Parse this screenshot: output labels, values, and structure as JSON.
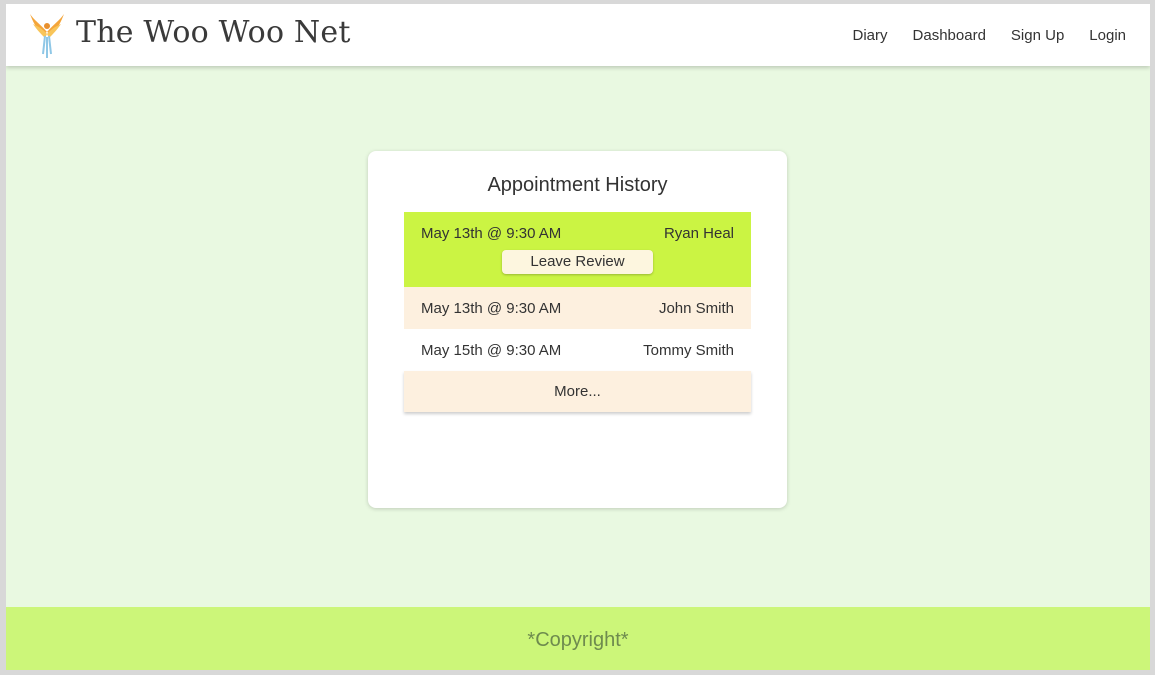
{
  "header": {
    "brand": "The Woo Woo Net",
    "logo_icon": "phoenix-logo-icon",
    "nav": [
      {
        "label": "Diary"
      },
      {
        "label": "Dashboard"
      },
      {
        "label": "Sign Up"
      },
      {
        "label": "Login"
      }
    ]
  },
  "card": {
    "title": "Appointment History",
    "appointments": [
      {
        "date": "May 13th @ 9:30 AM",
        "name": "Ryan Heal",
        "action": "Leave Review"
      },
      {
        "date": "May 13th @ 9:30 AM",
        "name": "John Smith"
      },
      {
        "date": "May 15th @ 9:30 AM",
        "name": "Tommy Smith"
      }
    ],
    "more_label": "More..."
  },
  "footer": {
    "copyright": "*Copyright*"
  },
  "colors": {
    "page_background": "#e9f9e1",
    "active_row": "#cbf443",
    "tan_row": "#fdf0df",
    "footer": "#ccf679",
    "footer_text": "#6e8b4e"
  }
}
